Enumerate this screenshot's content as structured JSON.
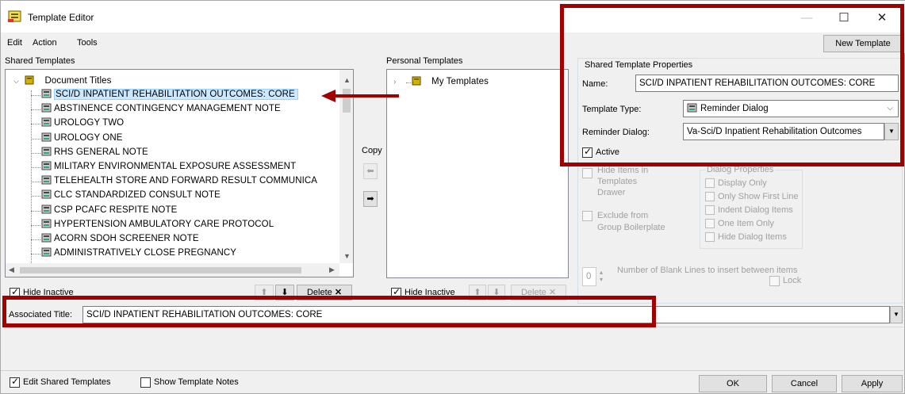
{
  "window": {
    "title": "Template Editor",
    "minimize": "—",
    "maximize": "☐",
    "close": "✕"
  },
  "menu": {
    "edit": "Edit",
    "action": "Action",
    "tools": "Tools"
  },
  "new_template_button": "New Template",
  "shared": {
    "header": "Shared Templates",
    "root": "Document Titles",
    "items": [
      "SCI/D INPATIENT REHABILITATION OUTCOMES: CORE",
      "ABSTINENCE CONTINGENCY MANAGEMENT NOTE",
      "UROLOGY TWO",
      "UROLOGY ONE",
      "RHS GENERAL NOTE",
      "MILITARY ENVIRONMENTAL EXPOSURE ASSESSMENT",
      "TELEHEALTH STORE AND FORWARD RESULT COMMUNICA",
      "CLC STANDARDIZED CONSULT NOTE",
      "CSP PCAFC RESPITE NOTE",
      "HYPERTENSION AMBULATORY CARE PROTOCOL",
      "ACORN SDOH SCREENER NOTE",
      "ADMINISTRATIVELY CLOSE PREGNANCY"
    ],
    "hide_inactive": "Hide Inactive",
    "delete": "Delete"
  },
  "copy_label": "Copy",
  "personal": {
    "header": "Personal Templates",
    "root": "My Templates",
    "hide_inactive": "Hide Inactive",
    "delete": "Delete"
  },
  "props": {
    "group_title": "Shared Template Properties",
    "name_label": "Name:",
    "name_value": "SCI/D INPATIENT REHABILITATION OUTCOMES: CORE",
    "type_label": "Template Type:",
    "type_value": "Reminder Dialog",
    "reminder_label": "Reminder Dialog:",
    "reminder_value": "Va-Sci/D Inpatient Rehabilitation Outcomes",
    "active_label": "Active",
    "hide_items_1": "Hide Items in",
    "hide_items_2": "Templates",
    "hide_items_3": "Drawer",
    "exclude_1": "Exclude from",
    "exclude_2": "Group Boilerplate",
    "dialog_props_title": "Dialog Properties",
    "dialog_opts": [
      "Display Only",
      "Only Show First Line",
      "Indent Dialog Items",
      "One Item Only",
      "Hide Dialog Items"
    ],
    "blank_lines_value": "0",
    "blank_lines_label": "Number of Blank Lines to insert between items",
    "lock": "Lock"
  },
  "associated": {
    "label": "Associated Title:",
    "value": "SCI/D INPATIENT REHABILITATION OUTCOMES: CORE"
  },
  "footer": {
    "edit_shared": "Edit Shared Templates",
    "show_notes": "Show Template Notes",
    "ok": "OK",
    "cancel": "Cancel",
    "apply": "Apply"
  },
  "colors": {
    "annotation_red": "#a00000",
    "selection": "#cce8ff"
  }
}
